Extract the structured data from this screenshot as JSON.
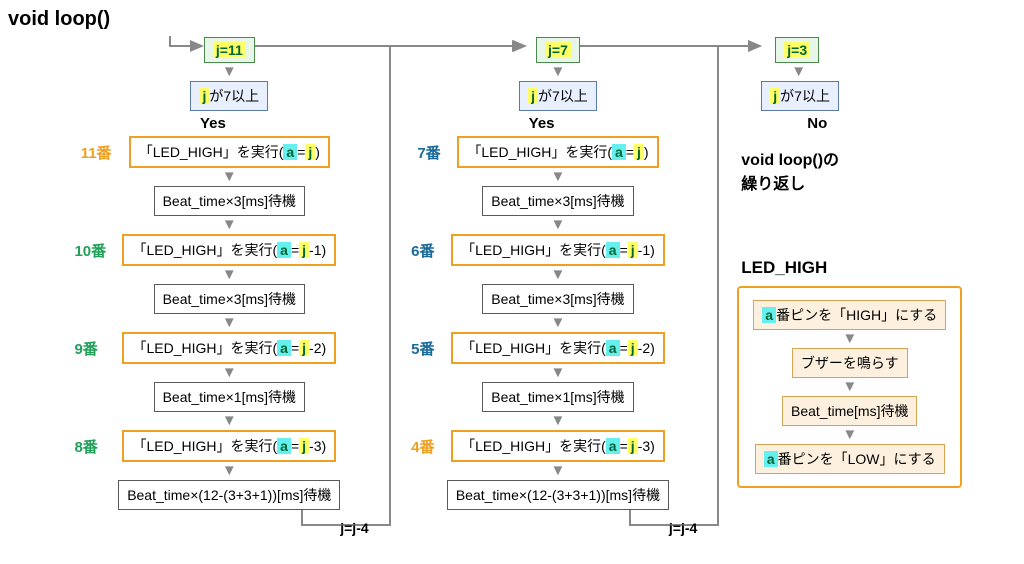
{
  "title": "void loop()",
  "columns": [
    {
      "init": "j=11",
      "cond_prefix": "j",
      "cond": "が7以上",
      "branch": "Yes",
      "labels": [
        "11番",
        "10番",
        "9番",
        "8番"
      ],
      "label_colors": [
        "o",
        "g",
        "g",
        "g"
      ],
      "steps": [
        {
          "type": "exec",
          "pre": "「LED_HIGH」を実行(",
          "mid": "a=j",
          "suf": ")"
        },
        {
          "type": "wait",
          "text": "Beat_time×3[ms]待機"
        },
        {
          "type": "exec",
          "pre": "「LED_HIGH」を実行(",
          "mid": "a=j",
          "suf": "-1)"
        },
        {
          "type": "wait",
          "text": "Beat_time×3[ms]待機"
        },
        {
          "type": "exec",
          "pre": "「LED_HIGH」を実行(",
          "mid": "a=j",
          "suf": "-2)"
        },
        {
          "type": "wait",
          "text": "Beat_time×1[ms]待機"
        },
        {
          "type": "exec",
          "pre": "「LED_HIGH」を実行(",
          "mid": "a=j",
          "suf": "-3)"
        },
        {
          "type": "wait",
          "text": "Beat_time×(12-(3+3+1))[ms]待機"
        }
      ],
      "dec": "j=j-4"
    },
    {
      "init": "j=7",
      "cond_prefix": "j",
      "cond": "が7以上",
      "branch": "Yes",
      "labels": [
        "7番",
        "6番",
        "5番",
        "4番"
      ],
      "label_colors": [
        "b",
        "b",
        "b",
        "o"
      ],
      "steps": [
        {
          "type": "exec",
          "pre": "「LED_HIGH」を実行(",
          "mid": "a=j",
          "suf": ")"
        },
        {
          "type": "wait",
          "text": "Beat_time×3[ms]待機"
        },
        {
          "type": "exec",
          "pre": "「LED_HIGH」を実行(",
          "mid": "a=j",
          "suf": "-1)"
        },
        {
          "type": "wait",
          "text": "Beat_time×3[ms]待機"
        },
        {
          "type": "exec",
          "pre": "「LED_HIGH」を実行(",
          "mid": "a=j",
          "suf": "-2)"
        },
        {
          "type": "wait",
          "text": "Beat_time×1[ms]待機"
        },
        {
          "type": "exec",
          "pre": "「LED_HIGH」を実行(",
          "mid": "a=j",
          "suf": "-3)"
        },
        {
          "type": "wait",
          "text": "Beat_time×(12-(3+3+1))[ms]待機"
        }
      ],
      "dec": "j=j-4"
    },
    {
      "init": "j=3",
      "cond_prefix": "j",
      "cond": "が7以上",
      "branch": "No",
      "note": "void loop()の\n繰り返し"
    }
  ],
  "led_high": {
    "title": "LED_HIGH",
    "s1_pre": "",
    "s1_a": "a",
    "s1_suf": "番ピンを「HIGH」にする",
    "s2": "ブザーを鳴らす",
    "s3": "Beat_time[ms]待機",
    "s4_pre": "",
    "s4_a": "a",
    "s4_suf": "番ピンを「LOW」にする"
  }
}
